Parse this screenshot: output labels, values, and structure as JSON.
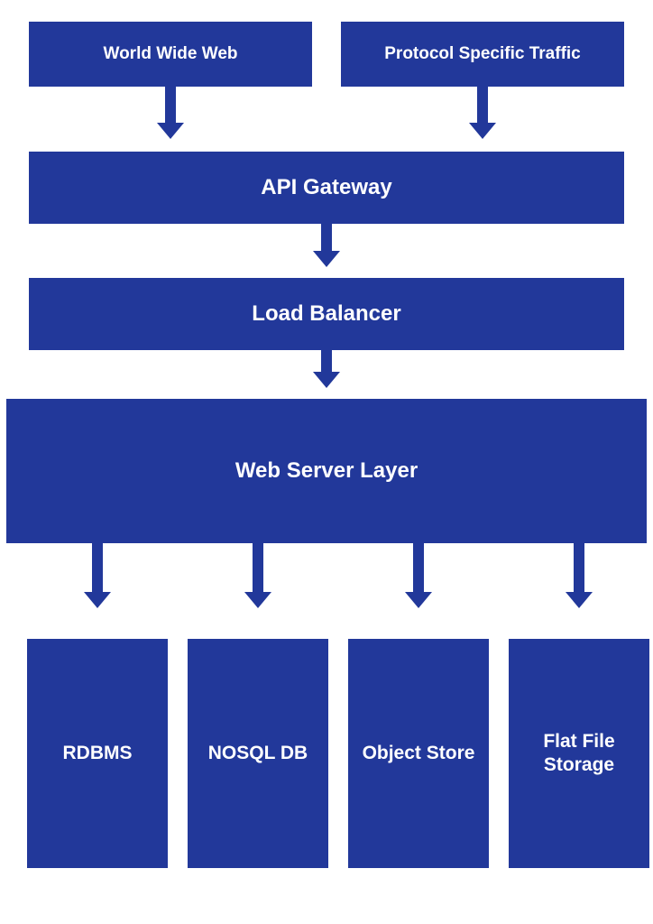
{
  "top": {
    "left": "World Wide Web",
    "right": "Protocol Specific Traffic"
  },
  "layers": {
    "api_gateway": "API Gateway",
    "load_balancer": "Load Balancer",
    "web_server": "Web Server Layer"
  },
  "storage": {
    "rdbms": "RDBMS",
    "nosql": "NOSQL DB",
    "object_store": "Object Store",
    "flat_file": "Flat File Storage"
  },
  "colors": {
    "primary": "#22389a",
    "text": "#ffffff"
  }
}
